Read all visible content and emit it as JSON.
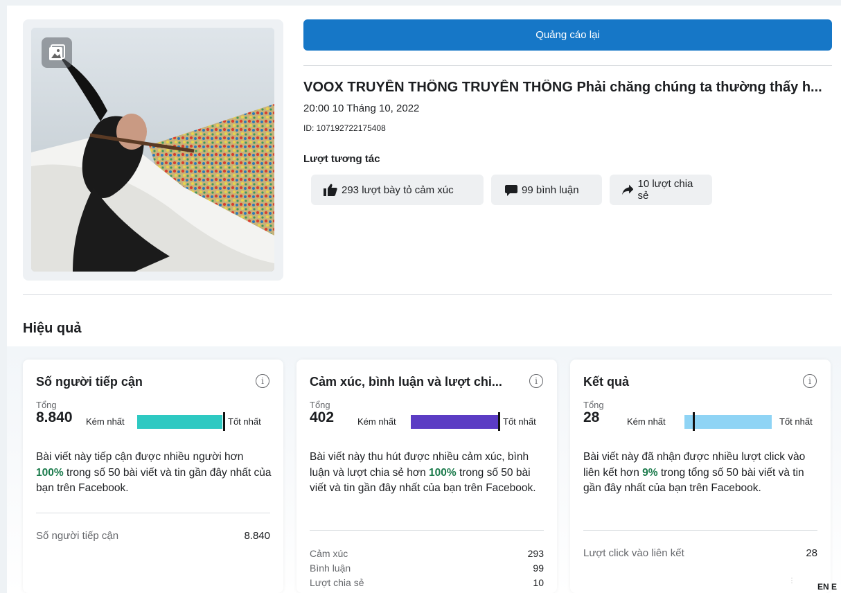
{
  "post": {
    "boost_label": "Quảng cáo lại",
    "title": "VOOX TRUYỀN THÔNG TRUYỀN THÔNG Phải chăng chúng ta thường thấy h...",
    "date": "20:00 10 Tháng 10, 2022",
    "id_text": "ID: 107192722175408",
    "engagement_label": "Lượt tương tác",
    "reactions": "293 lượt bày tỏ cảm xúc",
    "comments": "99 bình luận",
    "shares": "10 lượt chia sẻ"
  },
  "performance": {
    "title": "Hiệu quả",
    "cards": [
      {
        "title": "Số người tiếp cận",
        "total_label": "Tổng",
        "total": "8.840",
        "worst": "Kém nhất",
        "best": "Tốt nhất",
        "bar_color": "#2ec9c2",
        "desc_pre": "Bài viết này tiếp cận được nhiều người hơn ",
        "desc_pct": "100%",
        "desc_post": " trong số 50 bài viết và tin gần đây nhất của bạn trên Facebook.",
        "rows": [
          {
            "label": "Số người tiếp cận",
            "value": "8.840"
          }
        ]
      },
      {
        "title": "Cảm xúc, bình luận và lượt chi...",
        "total_label": "Tổng",
        "total": "402",
        "worst": "Kém nhất",
        "best": "Tốt nhất",
        "bar_color": "#5b3cc4",
        "desc_pre": "Bài viết này thu hút được nhiều cảm xúc, bình luận và lượt chia sẻ hơn ",
        "desc_pct": "100%",
        "desc_post": " trong số 50 bài viết và tin gần đây nhất của bạn trên Facebook.",
        "rows": [
          {
            "label": "Cảm xúc",
            "value": "293"
          },
          {
            "label": "Bình luận",
            "value": "99"
          },
          {
            "label": "Lượt chia sẻ",
            "value": "10"
          }
        ]
      },
      {
        "title": "Kết quả",
        "total_label": "Tổng",
        "total": "28",
        "worst": "Kém nhất",
        "best": "Tốt nhất",
        "bar_color": "#8fd4f5",
        "desc_pre": "Bài viết này đã nhận được nhiều lượt click vào liên kết hơn ",
        "desc_pct": "9%",
        "desc_post": " trong tổng số 50 bài viết và tin gần đây nhất của bạn trên Facebook.",
        "rows": [
          {
            "label": "Lượt click vào liên kết",
            "value": "28"
          }
        ]
      }
    ]
  },
  "footer": {
    "lang": "EN E"
  }
}
